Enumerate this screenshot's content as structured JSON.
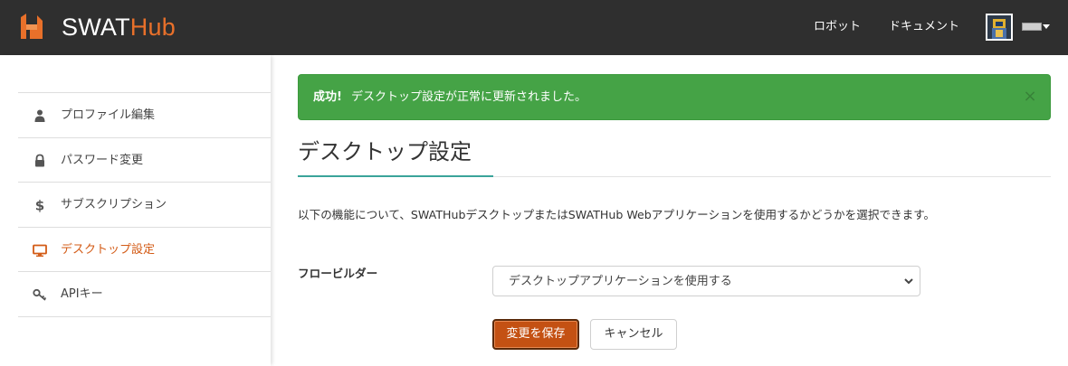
{
  "header": {
    "brand_part1": "SWAT",
    "brand_part2": "Hub",
    "brand_color": "#e8702a",
    "nav": [
      {
        "label": "ロボット"
      },
      {
        "label": "ドキュメント"
      }
    ],
    "logo_icon": "swathub-logo-icon",
    "avatar_icon": "user-avatar",
    "menu_icon": "caret-down-icon"
  },
  "sidebar": {
    "items": [
      {
        "label": "プロファイル編集",
        "icon": "user-icon",
        "active": false
      },
      {
        "label": "パスワード変更",
        "icon": "lock-icon",
        "active": false
      },
      {
        "label": "サブスクリプション",
        "icon": "dollar-icon",
        "active": false
      },
      {
        "label": "デスクトップ設定",
        "icon": "monitor-icon",
        "active": true
      },
      {
        "label": "APIキー",
        "icon": "key-icon",
        "active": false
      }
    ],
    "active_color": "#d35b16"
  },
  "alert": {
    "strong": "成功!",
    "message": "デスクトップ設定が正常に更新されました。",
    "close": "×",
    "color": "#45a346"
  },
  "main": {
    "title": "デスクトップ設定",
    "accent_color": "#3aa39a",
    "description": "以下の機能について、SWATHubデスクトップまたはSWATHub Webアプリケーションを使用するかどうかを選択できます。",
    "field_label": "フロービルダー",
    "select_value": "デスクトップアプリケーションを使用する",
    "save_label": "変更を保存",
    "cancel_label": "キャンセル",
    "save_color": "#c45113"
  }
}
